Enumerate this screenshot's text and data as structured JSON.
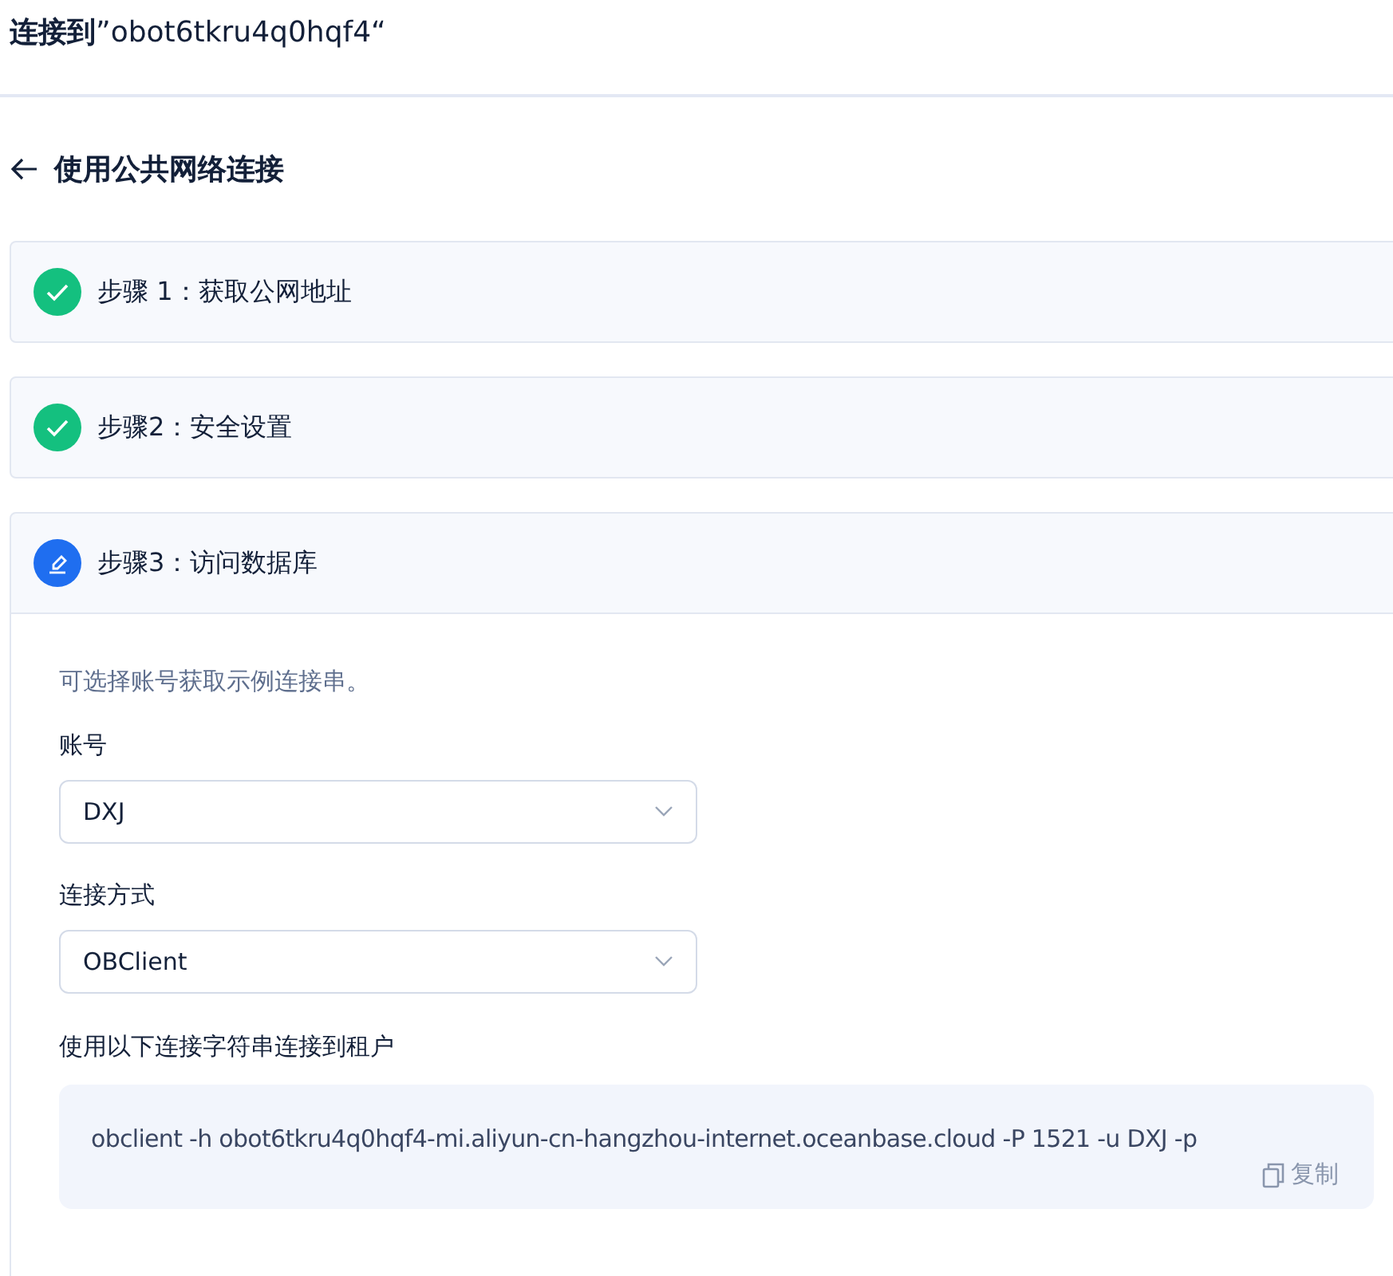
{
  "header": {
    "title": "**连接到**”obot6tkru4q0hqf4“"
  },
  "subpage": {
    "title": "使用公共网络连接"
  },
  "steps": [
    {
      "label": "步骤 1：获取公网地址",
      "completed": true
    },
    {
      "label": "步骤2：安全设置",
      "completed": true
    },
    {
      "label": "步骤3：访问数据库",
      "completed": false
    }
  ],
  "step_body": {
    "hint": "可选择账号获取示例连接串。",
    "fields": [
      {
        "label": "账号",
        "value": "DXJ"
      },
      {
        "label": "连接方式",
        "value": "OBClient"
      }
    ],
    "connection_label": "使用以下连接字符串连接到租户",
    "command": "obclient -h obot6tkru4q0hqf4-mi.aliyun-cn-hangzhou-internet.oceanbase.cloud -P 1521 -u DXJ -p",
    "copy_label": "复制"
  }
}
